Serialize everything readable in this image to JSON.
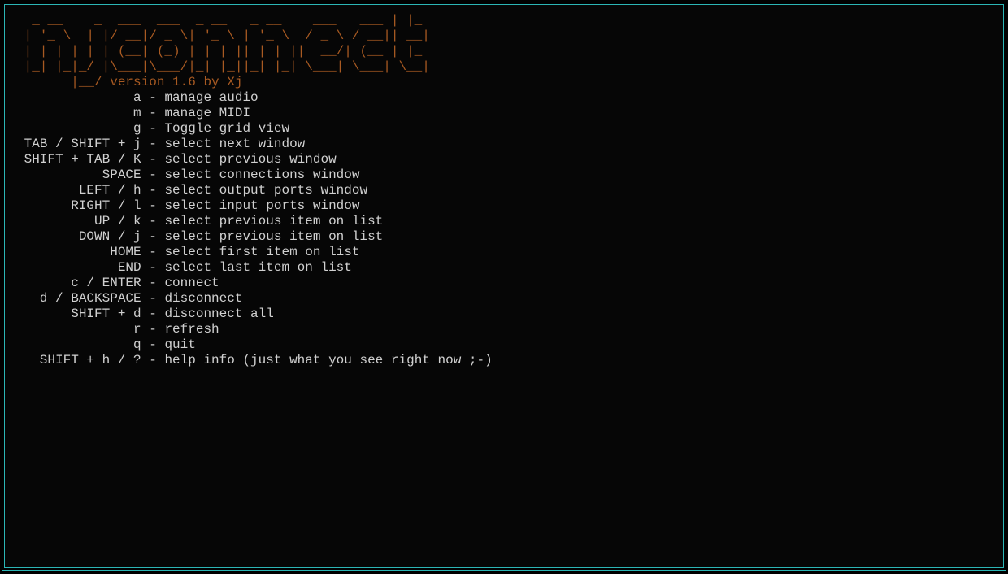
{
  "logo": "  _ __    _  ___  ___  _ __   _ __    ___   ___ | |_\n | '_ \\  | |/ __|/ _ \\| '_ \\ | '_ \\  / _ \\ / __|| __|\n | | | | | | (__| (_) | | | || | | ||  __/| (__ | |_\n |_| |_|_/ |\\___|\\___/|_| |_||_| |_| \\___| \\___| \\__|",
  "version_prefix": "       |__/ ",
  "version_text": "version 1.6 by Xj",
  "help_items": [
    {
      "key": "a",
      "desc": "manage audio"
    },
    {
      "key": "m",
      "desc": "manage MIDI"
    },
    {
      "key": "g",
      "desc": "Toggle grid view"
    },
    {
      "key": "TAB / SHIFT + j",
      "desc": "select next window"
    },
    {
      "key": "SHIFT + TAB / K",
      "desc": "select previous window"
    },
    {
      "key": "SPACE",
      "desc": "select connections window"
    },
    {
      "key": "LEFT / h",
      "desc": "select output ports window"
    },
    {
      "key": "RIGHT / l",
      "desc": "select input ports window"
    },
    {
      "key": "UP / k",
      "desc": "select previous item on list"
    },
    {
      "key": "DOWN / j",
      "desc": "select previous item on list"
    },
    {
      "key": "HOME",
      "desc": "select first item on list"
    },
    {
      "key": "END",
      "desc": "select last item on list"
    },
    {
      "key": "c / ENTER",
      "desc": "connect"
    },
    {
      "key": "d / BACKSPACE",
      "desc": "disconnect"
    },
    {
      "key": "SHIFT + d",
      "desc": "disconnect all"
    },
    {
      "key": "r",
      "desc": "refresh"
    },
    {
      "key": "q",
      "desc": "quit"
    },
    {
      "key": "SHIFT + h / ?",
      "desc": "help info (just what you see right now ;-)"
    }
  ],
  "key_column_width": 16
}
